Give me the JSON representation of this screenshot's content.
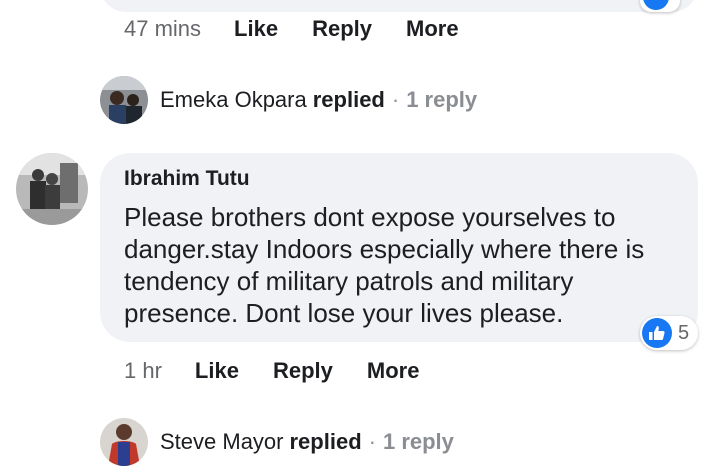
{
  "top_comment": {
    "time": "47 mins",
    "like_label": "Like",
    "reply_label": "Reply",
    "more_label": "More"
  },
  "thread_replies_1": {
    "name": "Emeka Okpara",
    "replied_word": "replied",
    "separator": "·",
    "count_label": "1 reply"
  },
  "main_comment": {
    "author": "Ibrahim Tutu",
    "text": "Please brothers dont expose yourselves to danger.stay Indoors especially where there is tendency of military patrols and military presence. Dont lose your lives please.",
    "reaction_count": "5",
    "reaction_color": "#1877f2",
    "time": "1 hr",
    "like_label": "Like",
    "reply_label": "Reply",
    "more_label": "More"
  },
  "thread_replies_2": {
    "name": "Steve Mayor",
    "replied_word": "replied",
    "separator": "·",
    "count_label": "1 reply"
  }
}
